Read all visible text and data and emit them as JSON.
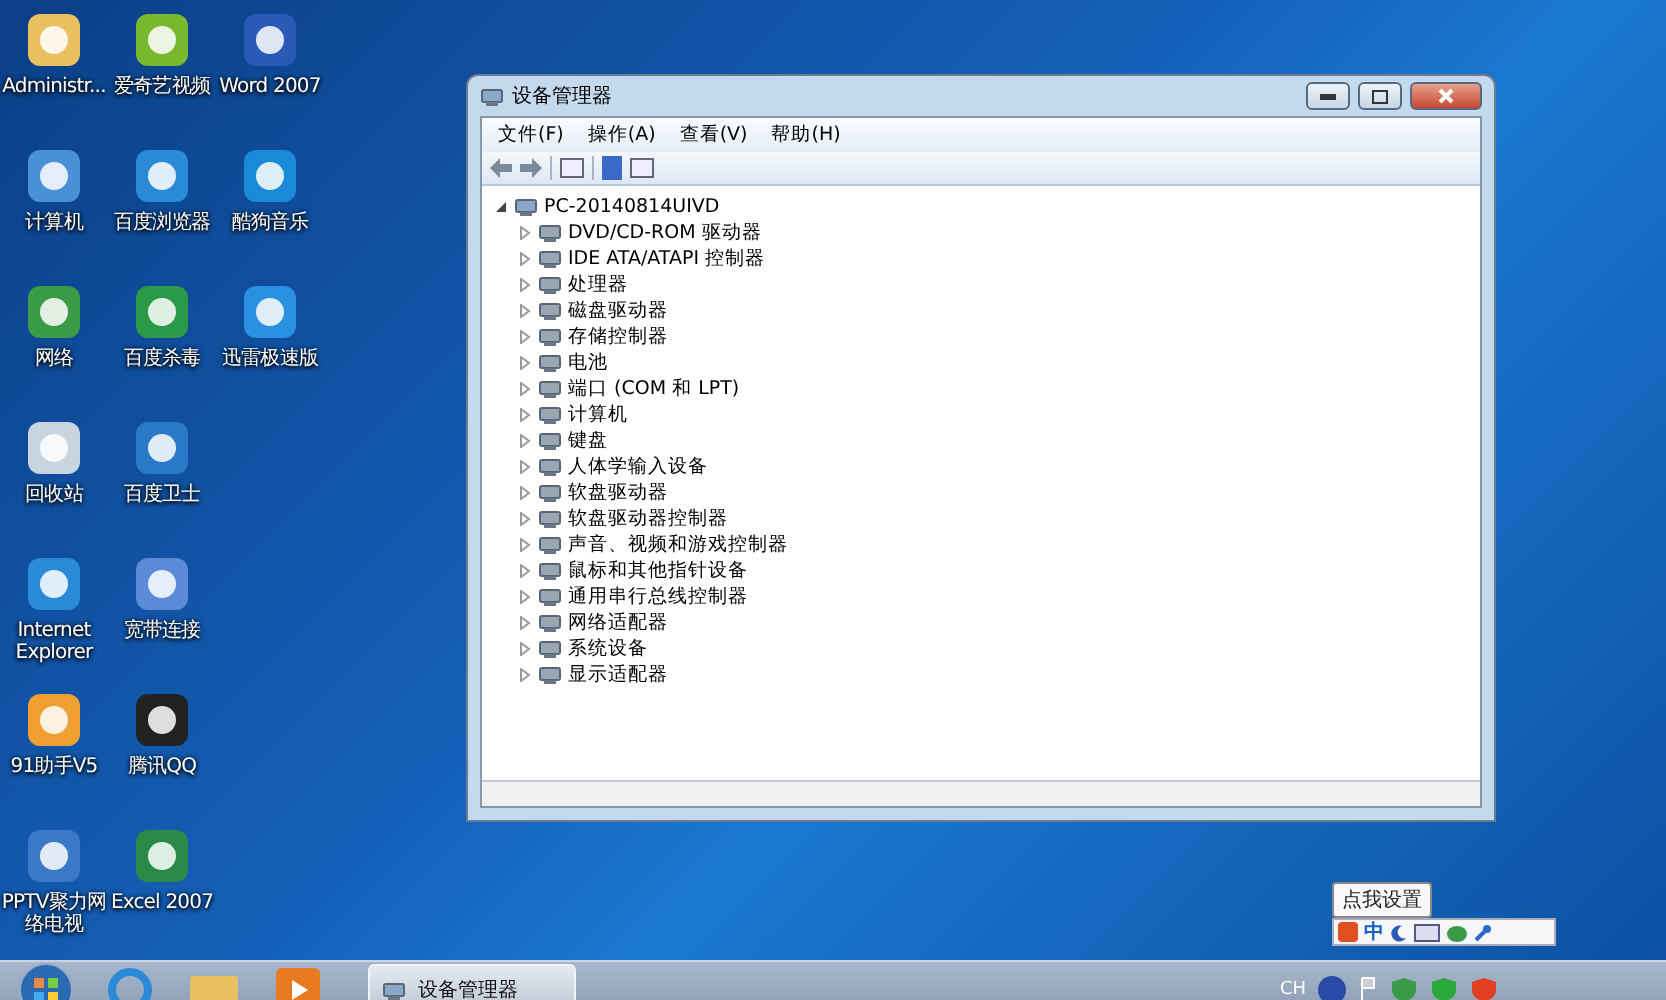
{
  "desktop_icons": [
    {
      "label": "Administr..."
    },
    {
      "label": "计算机"
    },
    {
      "label": "网络"
    },
    {
      "label": "回收站"
    },
    {
      "label": "Internet Explorer"
    },
    {
      "label": "91助手V5"
    },
    {
      "label": "PPTV聚力网络电视"
    },
    {
      "label": "爱奇艺视频"
    },
    {
      "label": "百度浏览器"
    },
    {
      "label": "百度杀毒"
    },
    {
      "label": "百度卫士"
    },
    {
      "label": "宽带连接"
    },
    {
      "label": "腾讯QQ"
    },
    {
      "label": "Excel 2007"
    },
    {
      "label": "Word 2007"
    },
    {
      "label": "酷狗音乐"
    },
    {
      "label": "迅雷极速版"
    }
  ],
  "window": {
    "title": "设备管理器",
    "menu": [
      "文件(F)",
      "操作(A)",
      "查看(V)",
      "帮助(H)"
    ],
    "tree": {
      "label": "PC-20140814UIVD",
      "expanded": true,
      "children": [
        {
          "label": "DVD/CD-ROM 驱动器",
          "expanded": false
        },
        {
          "label": "IDE ATA/ATAPI 控制器",
          "expanded": false
        },
        {
          "label": "处理器",
          "expanded": false
        },
        {
          "label": "磁盘驱动器",
          "expanded": false
        },
        {
          "label": "存储控制器",
          "expanded": false
        },
        {
          "label": "电池",
          "expanded": false
        },
        {
          "label": "端口 (COM 和 LPT)",
          "expanded": false
        },
        {
          "label": "计算机",
          "expanded": false
        },
        {
          "label": "键盘",
          "expanded": false
        },
        {
          "label": "人体学输入设备",
          "expanded": false
        },
        {
          "label": "软盘驱动器",
          "expanded": false
        },
        {
          "label": "软盘驱动器控制器",
          "expanded": false
        },
        {
          "label": "声音、视频和游戏控制器",
          "expanded": false
        },
        {
          "label": "鼠标和其他指针设备",
          "expanded": false
        },
        {
          "label": "通用串行总线控制器",
          "expanded": false
        },
        {
          "label": "网络适配器",
          "expanded": false
        },
        {
          "label": "系统设备",
          "expanded": false
        },
        {
          "label": "显示适配器",
          "expanded": false
        }
      ]
    }
  },
  "tooltip": "点我设置",
  "ime_bar": {
    "mode": "中"
  },
  "taskbar": {
    "task": {
      "label": "设备管理器",
      "selected": true
    },
    "language": "CH"
  }
}
